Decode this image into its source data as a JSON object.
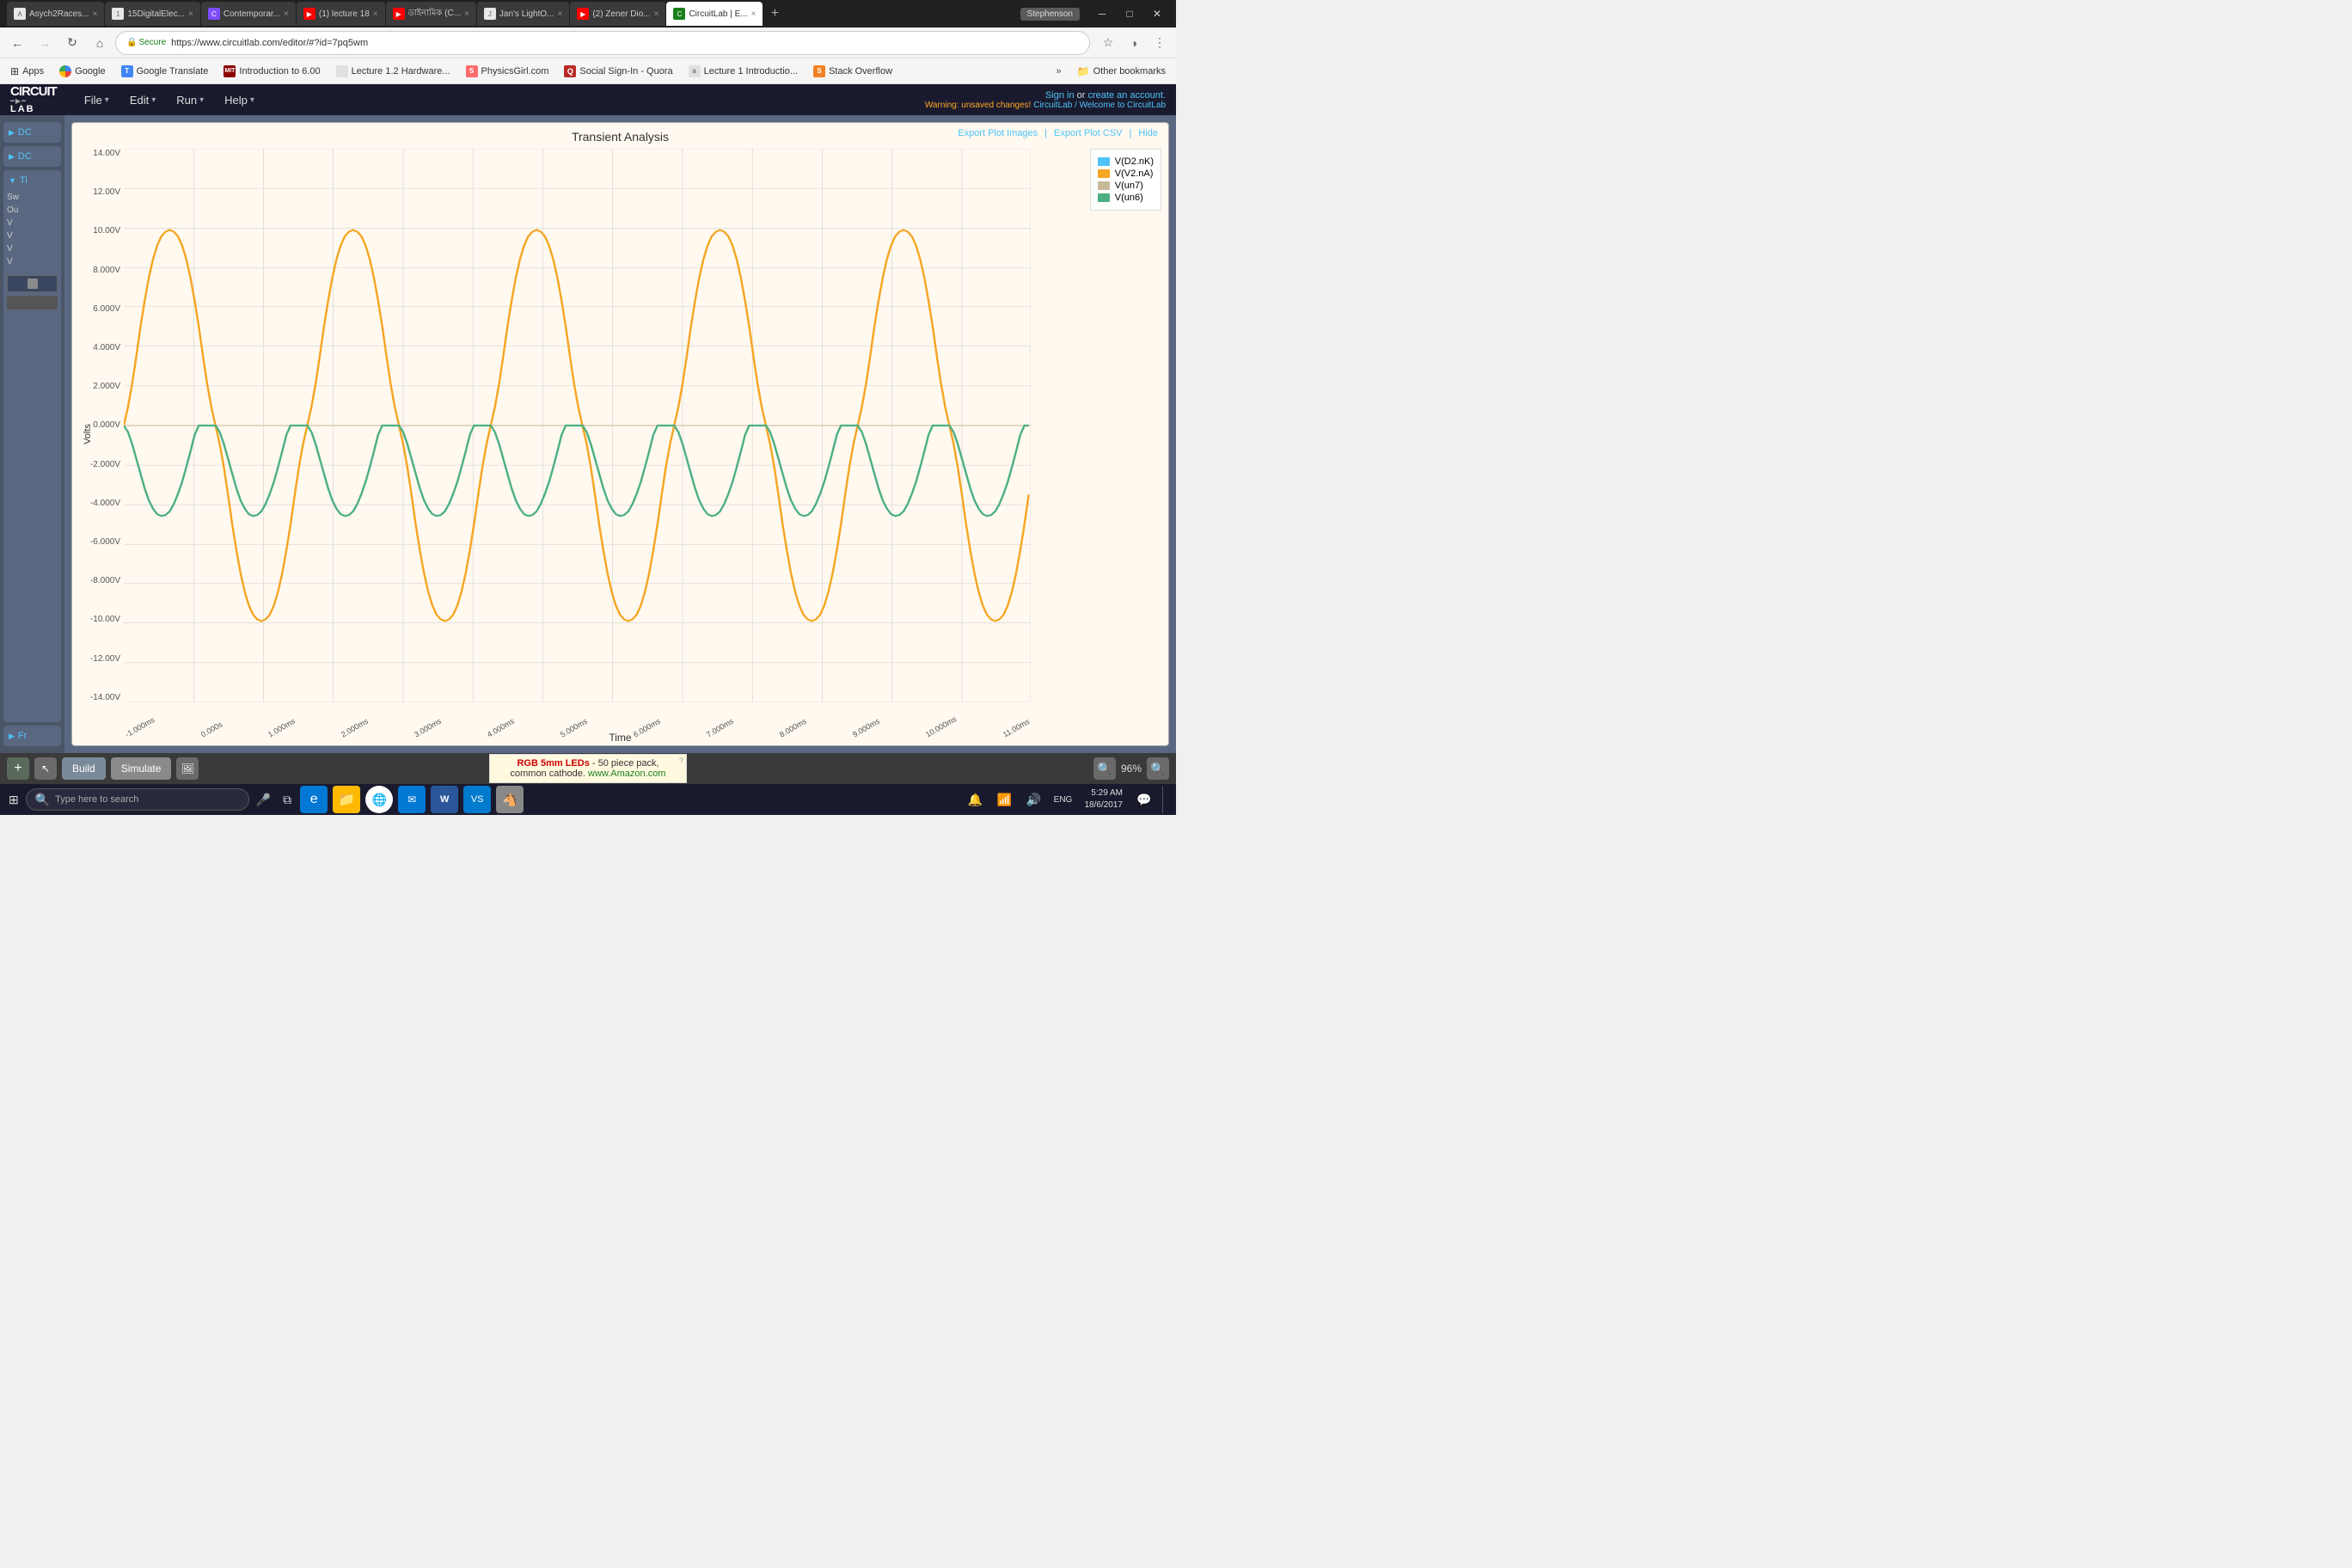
{
  "browser": {
    "tabs": [
      {
        "id": "t1",
        "label": "Asych2Races...",
        "active": false,
        "favicon_color": "#e0e0e0"
      },
      {
        "id": "t2",
        "label": "15DigitalElec...",
        "active": false,
        "favicon_color": "#e0e0e0"
      },
      {
        "id": "t3",
        "label": "Contemporar...",
        "active": false,
        "favicon_color": "#7c4dff"
      },
      {
        "id": "t4",
        "label": "(1) lecture 18",
        "active": false,
        "favicon_color": "#ff0000"
      },
      {
        "id": "t5",
        "label": "ডাইনামিক (C...",
        "active": false,
        "favicon_color": "#ff0000"
      },
      {
        "id": "t6",
        "label": "Jan's LightO...",
        "active": false,
        "favicon_color": "#e0e0e0"
      },
      {
        "id": "t7",
        "label": "(2) Zener Dio...",
        "active": false,
        "favicon_color": "#ff0000"
      },
      {
        "id": "t8",
        "label": "CircuitLab | E...",
        "active": true,
        "favicon_color": "#1a7f1a"
      }
    ],
    "url": "https://www.circuitlab.com/editor/#?id=7pq5wm",
    "secure_label": "Secure",
    "user_name": "Stephenson"
  },
  "bookmarks": [
    {
      "label": "Apps",
      "type": "apps"
    },
    {
      "label": "Google",
      "type": "google"
    },
    {
      "label": "Google Translate",
      "type": "translate"
    },
    {
      "label": "Introduction to 6.00",
      "type": "mit"
    },
    {
      "label": "Lecture 1.2 Hardware...",
      "type": "link"
    },
    {
      "label": "PhysicsGirl.com",
      "type": "link"
    },
    {
      "label": "Social Sign-In - Quora",
      "type": "quora"
    },
    {
      "label": "Lecture 1 Introductio...",
      "type": "link"
    },
    {
      "label": "Stack Overflow",
      "type": "stackoverflow"
    },
    {
      "label": "Other bookmarks",
      "type": "folder"
    }
  ],
  "app": {
    "title": "CircuitLab",
    "logo_line1": "CIRCUIT",
    "logo_line2": "LAB",
    "menu_items": [
      "File",
      "Edit",
      "Run",
      "Help"
    ],
    "sign_in_text": "Sign in",
    "or_text": "or",
    "create_account_text": "create an account.",
    "warning_text": "Warning: unsaved changes!",
    "breadcrumb": "CircuitLab / Welcome to CircuitLab"
  },
  "sidebar": {
    "sections": [
      {
        "label": "DC",
        "expanded": false
      },
      {
        "label": "DC",
        "expanded": false
      },
      {
        "label": "Ti",
        "expanded": true,
        "items": [
          "Sw",
          "Ou",
          "V",
          "V",
          "V",
          "V"
        ]
      }
    ],
    "freq_label": "Fr"
  },
  "chart": {
    "title": "Transient Analysis",
    "export_images": "Export Plot Images",
    "export_csv": "Export Plot CSV",
    "hide": "Hide",
    "y_axis_title": "Volts",
    "x_axis_title": "Time",
    "y_labels": [
      "14.00V",
      "12.00V",
      "10.00V",
      "8.000V",
      "6.000V",
      "4.000V",
      "2.000V",
      "0.000V",
      "-2.000V",
      "-4.000V",
      "-6.000V",
      "-8.000V",
      "-10.00V",
      "-12.00V",
      "-14.00V"
    ],
    "x_labels": [
      "-1.000ms",
      "0.000s",
      "1.000ms",
      "2.000ms",
      "3.000ms",
      "4.000ms",
      "5.000ms",
      "6.000ms",
      "7.000ms",
      "8.000ms",
      "9.000ms",
      "10.000ms",
      "11.00ms"
    ],
    "legend": [
      {
        "label": "V(D2.nK)",
        "color": "#4fc3f7"
      },
      {
        "label": "V(V2.nA)",
        "color": "#f5a623"
      },
      {
        "label": "V(un7)",
        "color": "#c8b89a"
      },
      {
        "label": "V(un6)",
        "color": "#4caf82"
      }
    ]
  },
  "bottom_toolbar": {
    "build_label": "Build",
    "simulate_label": "Simulate",
    "ad_text": "RGB 5mm LEDs",
    "ad_sub": " - 50 piece pack,",
    "ad_sub2": "common cathode.",
    "ad_link": "www.Amazon.com",
    "zoom_level": "96%"
  },
  "taskbar": {
    "search_placeholder": "Type here to search",
    "time": "5:29 AM",
    "date": "18/6/2017",
    "lang": "ENG"
  }
}
